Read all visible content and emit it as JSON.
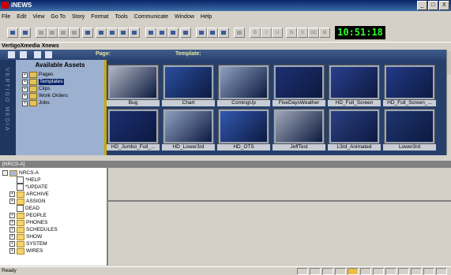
{
  "window": {
    "title": "iNEWS",
    "min": "_",
    "max": "□",
    "close": "X"
  },
  "menu": [
    "File",
    "Edit",
    "View",
    "Go To",
    "Story",
    "Format",
    "Tools",
    "Communicate",
    "Window",
    "Help"
  ],
  "toolbar": {
    "clock": "10:51:18",
    "letters": [
      "B",
      "I",
      "U",
      "N",
      "X",
      "OC",
      "M"
    ]
  },
  "vertigo": {
    "title": "VertigoXmedia Xnews",
    "page_label": "Page:",
    "template_label": "Template:",
    "side_text": "VERTIGO MEDIA",
    "assets_header": "Available Assets",
    "tree": [
      {
        "label": "Pages",
        "selected": false
      },
      {
        "label": "Templates",
        "selected": true
      },
      {
        "label": "Clips",
        "selected": false
      },
      {
        "label": "Work Orders",
        "selected": false
      },
      {
        "label": "Jobs",
        "selected": false
      }
    ],
    "thumbs": [
      {
        "label": "Bug",
        "color": "#b0b6c2"
      },
      {
        "label": "Chart",
        "color": "#2a4fa0"
      },
      {
        "label": "ComingUp",
        "color": "#8fa0c0"
      },
      {
        "label": "FiveDaysWeather",
        "color": "#1d2f73"
      },
      {
        "label": "HD_Full_Screen",
        "color": "#2a3f8f"
      },
      {
        "label": "HD_Full_Screen_...",
        "color": "#233a88"
      },
      {
        "label": "HD_Jumbo_Full_...",
        "color": "#1c2e70"
      },
      {
        "label": "HD_Lower3rd",
        "color": "#8fa0c0"
      },
      {
        "label": "HD_OTS",
        "color": "#3358b0"
      },
      {
        "label": "JeffTest",
        "color": "#a0a8b8"
      },
      {
        "label": "L3rd_Animated",
        "color": "#2c3f82"
      },
      {
        "label": "Lower3rd",
        "color": "#1f356f"
      }
    ]
  },
  "nrcs": {
    "header": "[NRCS-A]",
    "root": "NRCS-A",
    "items": [
      {
        "label": "*HELP",
        "type": "doc",
        "expandable": false
      },
      {
        "label": "*UPDATE",
        "type": "doc",
        "expandable": false
      },
      {
        "label": "ARCHIVE",
        "type": "folder",
        "expandable": true
      },
      {
        "label": "ASSIGN",
        "type": "folder",
        "expandable": true
      },
      {
        "label": "DEAD",
        "type": "doc",
        "expandable": false
      },
      {
        "label": "PEOPLE",
        "type": "folder",
        "expandable": true
      },
      {
        "label": "PHONES",
        "type": "folder",
        "expandable": true
      },
      {
        "label": "SCHEDULES",
        "type": "folder",
        "expandable": true
      },
      {
        "label": "SHOW",
        "type": "folder",
        "expandable": true
      },
      {
        "label": "SYSTEM",
        "type": "folder",
        "expandable": true
      },
      {
        "label": "WIRES",
        "type": "folder",
        "expandable": true
      }
    ]
  },
  "status": {
    "text": "Ready"
  }
}
